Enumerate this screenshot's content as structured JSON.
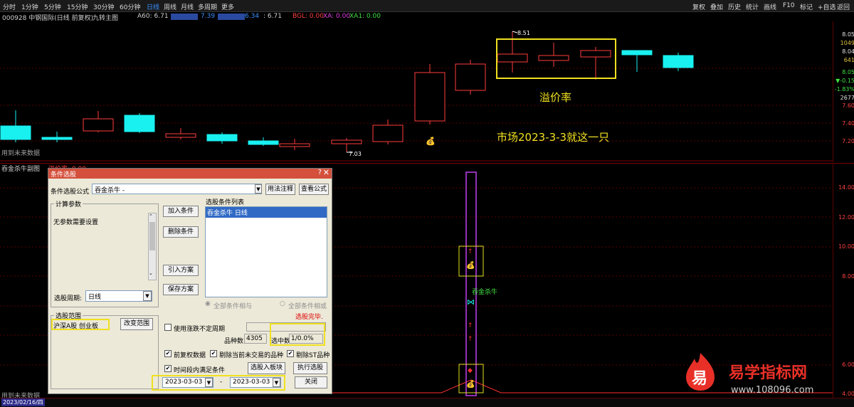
{
  "toolbar": {
    "periods": [
      "分时",
      "1分钟",
      "5分钟",
      "15分钟",
      "30分钟",
      "60分钟",
      "日线",
      "周线",
      "月线",
      "多周期",
      "更多"
    ],
    "right_buttons": [
      "复权",
      "叠加",
      "历史",
      "统计",
      "画线",
      "F10",
      "标记",
      "+自选",
      "返回"
    ]
  },
  "info": {
    "stock": "000928 中钢国际(日线 前复权)",
    "indicator": "九转主图",
    "a60": "A60: 6.71",
    "v1": "7.39",
    "v2": "6.34",
    "v3": ": 6.71",
    "bgl": "BGL: 0.00",
    "xa": "XA: 0.00",
    "xa1": "XA1: 0.00"
  },
  "main_axis": [
    "8.05",
    "1049",
    "8.04",
    "641",
    "8.05",
    "▼-0.15",
    "-1.83%",
    "2677",
    "7.60",
    "7.40",
    "7.20"
  ],
  "sub_axis": [
    "14.00",
    "12.00",
    "10.00",
    "8.00",
    "6.00",
    "4.00"
  ],
  "chart_annotations": {
    "high": "8.51",
    "low": "7.03",
    "premium": "溢价率",
    "market_note": "市场2023-3-3就这一只",
    "future_top": "用到未来数据",
    "future_bottom": "用到未来数据",
    "sub_title": "吞金杀牛副图",
    "sub_value": "溢价率: 0.00",
    "signal": "吞金杀牛",
    "date": "2023/02/16/四"
  },
  "dialog": {
    "title": "条件选股",
    "formula_label": "条件选股公式",
    "formula_value": "吞金杀牛     -",
    "usage_btn": "用法注释",
    "view_btn": "查看公式",
    "params_group": "计算参数",
    "params_text": "无参数需要设置",
    "add_btn": "加入条件",
    "delete_btn": "删除条件",
    "import_btn": "引入方案",
    "save_btn": "保存方案",
    "list_label": "选股条件列表",
    "list_item": "吞金杀牛   日线",
    "period_label": "选股周期:",
    "period_value": "日线",
    "and_label": "全部条件相与",
    "or_label": "全部条件相或",
    "status": "选股完毕.",
    "range_group": "选股范围",
    "range_value": "沪深A股 创业板",
    "range_btn": "改变范围",
    "uncertain_label": "使用涨跌不定周期",
    "count_label": "品种数",
    "count_value": "4305",
    "selected_label": "选中数",
    "selected_value": "1/0.0%",
    "fq_label": "前复权数据",
    "exclude_notrade": "剔除当前未交易的品种",
    "exclude_st": "剔除ST品种",
    "interval_label": "时间段内满足条件",
    "to_block_btn": "选股入板块",
    "run_btn": "执行选股",
    "date_from": "2023-03-03",
    "date_sep": "-",
    "date_to": "2023-03-03",
    "close_btn": "关闭"
  },
  "logo": {
    "mark": "易",
    "name": "易学指标网",
    "url": "www.108096.com"
  },
  "colors": {
    "up": "#ff3c3c",
    "down": "#19f0f0",
    "accent": "#3a8fff",
    "highlight": "#f0e020",
    "bg": "#000000"
  }
}
